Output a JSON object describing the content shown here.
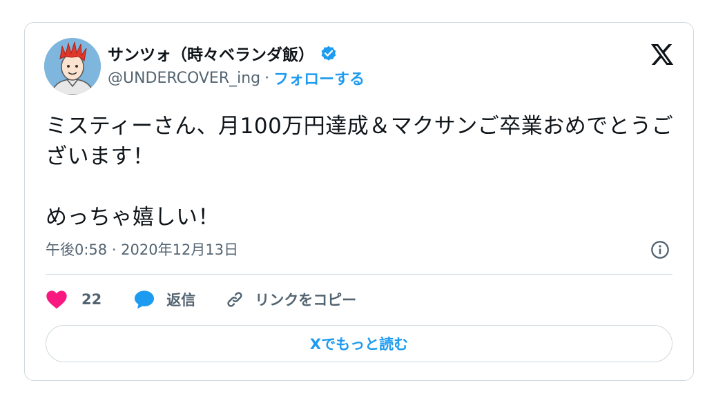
{
  "author": {
    "display_name": "サンツォ（時々ベランダ飯）",
    "handle": "@UNDERCOVER_ing",
    "separator": "·",
    "follow_label": "フォローする"
  },
  "tweet": {
    "paragraph1": "ミスティーさん、月100万円達成＆マクサンご卒業おめでとうございます！",
    "paragraph2": "めっちゃ嬉しい！",
    "timestamp": "午後0:58 · 2020年12月13日"
  },
  "actions": {
    "like_count": "22",
    "reply_label": "返信",
    "copy_link_label": "リンクをコピー"
  },
  "read_more_label": "Xでもっと読む",
  "colors": {
    "accent": "#1d9bf0",
    "like": "#f91880",
    "muted_text": "#536471",
    "border": "#cfd9de"
  },
  "icons": {
    "verified": "verified-badge-icon",
    "brand": "x-logo-icon",
    "info": "info-icon",
    "like": "heart-icon",
    "reply": "speech-bubble-icon",
    "copy_link": "link-icon"
  }
}
